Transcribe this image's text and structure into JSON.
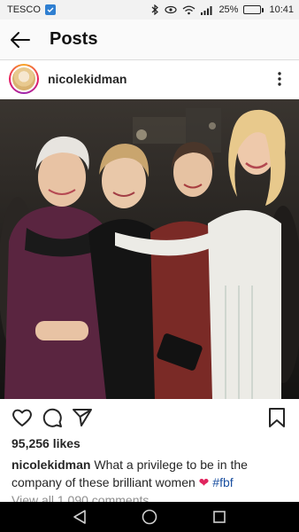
{
  "status_bar": {
    "carrier": "TESCO",
    "battery_percent": "25%",
    "battery_level": 0.25,
    "time": "10:41",
    "icons": [
      "bluetooth-icon",
      "eye-icon",
      "wifi-icon",
      "signal-icon",
      "battery-icon"
    ]
  },
  "header": {
    "title": "Posts",
    "back_icon": "arrow-left-icon"
  },
  "post": {
    "username": "nicolekidman",
    "more_icon": "vertical-dots-icon",
    "likes": "95,256 likes",
    "caption_user": "nicolekidman",
    "caption_text": " What a privilege to be in the company of these brilliant women ",
    "caption_emoji": "❤",
    "caption_hashtag": "#fbf",
    "comments_link": "View all 1,090 comments",
    "action_icons": [
      "heart-icon",
      "comment-icon",
      "share-icon",
      "bookmark-icon"
    ]
  },
  "nav_bar": {
    "icons": [
      "back-triangle-icon",
      "home-circle-icon",
      "recents-square-icon"
    ]
  },
  "colors": {
    "accent_heart": "#e0245e",
    "hashtag": "#1a4fa0",
    "battery": "#3ea64a",
    "carrier_badge": "#2f7fd1"
  }
}
